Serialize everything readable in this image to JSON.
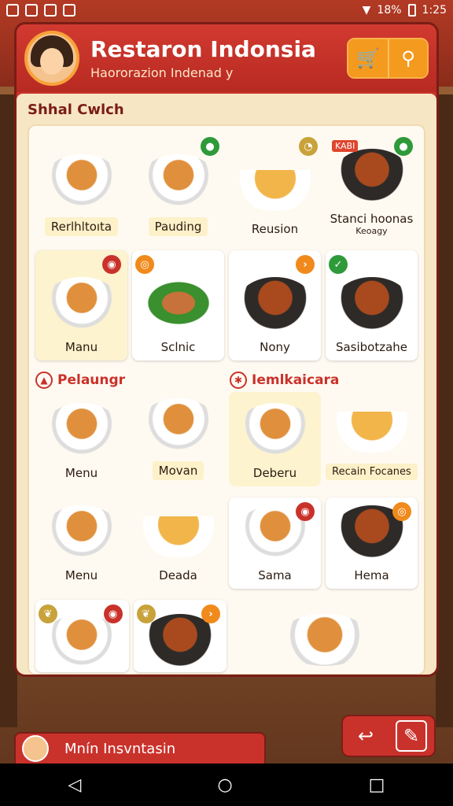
{
  "status": {
    "battery_text": "18%",
    "time": "1:25"
  },
  "header": {
    "title": "Restaron Indonsia",
    "subtitle": "Haororazion Indenad y",
    "btn_store": "🛒",
    "btn_search": "⚲"
  },
  "section": {
    "title": "Shhal Cwlch"
  },
  "row1": [
    {
      "label": "Rerlhltoıta"
    },
    {
      "label": "Pauding"
    },
    {
      "label": "Reusion"
    },
    {
      "label": "Stanci hoonas",
      "sub": "Keoagy",
      "tag": "KABI"
    }
  ],
  "row2": [
    {
      "label": "Manu"
    },
    {
      "label": "Sclnic"
    },
    {
      "label": "Nony"
    },
    {
      "label": "Sasibotzahe"
    }
  ],
  "sub_left": {
    "title": "Pelaungr"
  },
  "sub_right": {
    "title": "Iemlkaicara"
  },
  "row3": [
    {
      "label": "Menu"
    },
    {
      "label": "Movan"
    },
    {
      "label": "Deberu"
    },
    {
      "label": "Recain Focanes"
    }
  ],
  "row4": [
    {
      "label": "Menu"
    },
    {
      "label": "Deada"
    },
    {
      "label": "Sama"
    },
    {
      "label": "Hema"
    }
  ],
  "bottom": {
    "label": "Mnín Insvntasin"
  },
  "colors": {
    "primary": "#c9322b",
    "accent": "#f39a1f",
    "cream": "#f7e6c4"
  }
}
